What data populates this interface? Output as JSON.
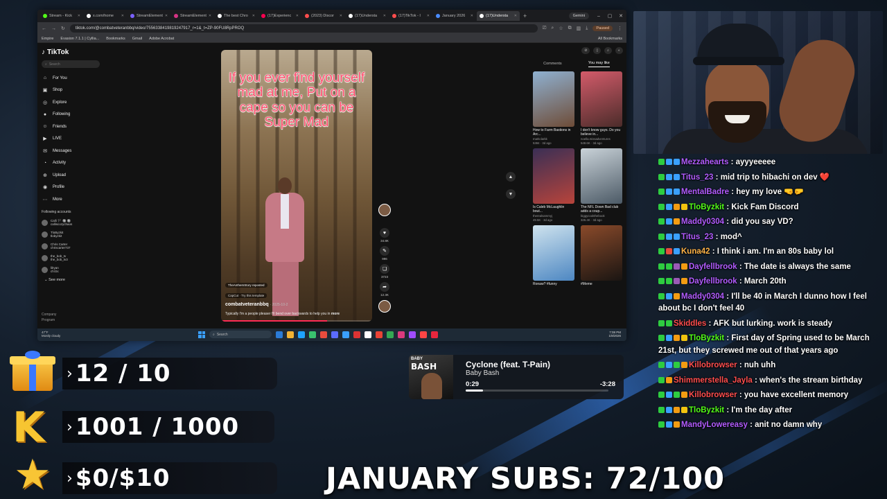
{
  "browser": {
    "tabs": [
      {
        "label": "Stream - Kick",
        "color": "#53fc18",
        "active": false
      },
      {
        "label": "x.com/home",
        "color": "#ffffff",
        "active": false
      },
      {
        "label": "StreamElement",
        "color": "#7b61ff",
        "active": false
      },
      {
        "label": "StreamElement",
        "color": "#d63384",
        "active": false
      },
      {
        "label": "The best Chro",
        "color": "#ffffff",
        "active": false
      },
      {
        "label": "(17)Experienc",
        "color": "#ff0050",
        "active": false
      },
      {
        "label": "(2023) Discor",
        "color": "#ff4d4d",
        "active": false
      },
      {
        "label": "(17)Understa",
        "color": "#ffffff",
        "active": false
      },
      {
        "label": "(17)TikTok - I",
        "color": "#ff4d4d",
        "active": false
      },
      {
        "label": "January 2026",
        "color": "#4a8cff",
        "active": false
      },
      {
        "label": "(17)Understa",
        "color": "#ffffff",
        "active": true
      }
    ],
    "new_tab": "+",
    "gemini_label": "Gemini",
    "window_controls": [
      "–",
      "▢",
      "✕"
    ],
    "url": "tiktok.com/@combatveteranbbq/video/7556338419819247917_r=1&_t=ZP-90FU8RpPROQ",
    "paused_label": "Paused",
    "bookmarks": [
      "Empire",
      "Evasion 7.1.1 | Cyllia...",
      "Bookmarks",
      "Gmail",
      "Adobe Acrobat"
    ],
    "all_bookmarks": "All Bookmarks"
  },
  "tiktok": {
    "logo": "TikTok",
    "search_placeholder": "Search",
    "nav": [
      {
        "label": "For You",
        "icon": "home-icon",
        "glyph": "⌂"
      },
      {
        "label": "Shop",
        "icon": "shop-icon",
        "glyph": "▣"
      },
      {
        "label": "Explore",
        "icon": "compass-icon",
        "glyph": "◎"
      },
      {
        "label": "Following",
        "icon": "following-icon",
        "glyph": "●"
      },
      {
        "label": "Friends",
        "icon": "friends-icon",
        "glyph": "☺"
      },
      {
        "label": "LIVE",
        "icon": "live-icon",
        "glyph": "▶"
      },
      {
        "label": "Messages",
        "icon": "messages-icon",
        "glyph": "✉"
      },
      {
        "label": "Activity",
        "icon": "activity-icon",
        "glyph": "◔"
      },
      {
        "label": "Upload",
        "icon": "upload-icon",
        "glyph": "⊕"
      },
      {
        "label": "Profile",
        "icon": "profile-icon",
        "glyph": "◉"
      },
      {
        "label": "More",
        "icon": "more-icon",
        "glyph": "⋯"
      }
    ],
    "following_title": "Following accounts",
    "following": [
      {
        "name": "Calli 🏳 🔘 🔘",
        "handle": "calliscozychaos"
      },
      {
        "name": "TloByzkit",
        "handle": "tlobyzkit"
      },
      {
        "name": "Chris Carter",
        "handle": "chriscarter737"
      },
      {
        "name": "the_bob_tv",
        "handle": "the_bob_tv3"
      },
      {
        "name": "lilryan",
        "handle": "chl.bc"
      }
    ],
    "see_more": "See more",
    "footer": [
      "Company",
      "Program"
    ],
    "video": {
      "caption": "If you ever find yourself mad at me, Put on a cape so you can be Super Mad",
      "reposted_tag": "TheAnthemStory reposted",
      "capcut": "CapCut · Try this template",
      "handle": "combatveteranbbq",
      "date": "· 2025-10-2",
      "description": "Typically I'm a people pleaser I'll bend over backwards to help you in",
      "more": "more",
      "progress": 0.7
    },
    "actions": [
      {
        "name": "like-icon",
        "glyph": "♥",
        "count": "34.8K"
      },
      {
        "name": "comment-icon",
        "glyph": "✎",
        "count": "996"
      },
      {
        "name": "bookmark-icon",
        "glyph": "❏",
        "count": "3723"
      },
      {
        "name": "share-icon",
        "glyph": "➦",
        "count": "12.3K"
      }
    ],
    "scroll_up": "▲",
    "scroll_down": "▼",
    "panel_tabs": [
      "Comments",
      "You may like"
    ],
    "panel_icons": [
      "⊘",
      "▯",
      "⌕",
      "◐"
    ],
    "suggestions": [
      {
        "title": "How to Farm Bastions in Arc...",
        "author": "markclarkk",
        "views": "5384",
        "age": "3d ago",
        "c1": "#8fb1d1",
        "c2": "#6e4c37"
      },
      {
        "title": "I don't know guys. Do you believe in...",
        "author": "noella.missadventures",
        "views": "548.6K",
        "age": "3d ago",
        "c1": "#d35b6a",
        "c2": "#4b2c2a"
      },
      {
        "title": "Is Caleb McLaughlin bout...",
        "author": "therealsammyj",
        "views": "49.5K",
        "age": "3d ago",
        "c1": "#3a2f55",
        "c2": "#b8443b"
      },
      {
        "title": "The NFL Down Bad club adds a coup...",
        "author": "biggycookthebook",
        "views": "326.4K",
        "age": "3d ago",
        "c1": "#c9d2d8",
        "c2": "#4c5a66"
      },
      {
        "title": "Ronaw? #funny",
        "author": "",
        "views": "",
        "age": "",
        "c1": "#cfe3ee",
        "c2": "#4d87c2"
      },
      {
        "title": "#Meme",
        "author": "",
        "views": "",
        "age": "",
        "c1": "#8a4a2a",
        "c2": "#1a1512"
      }
    ]
  },
  "taskbar": {
    "weather_temp": "47°F",
    "weather_desc": "Mostly cloudy",
    "search_placeholder": "Search",
    "apps": [
      "#2b7bd6",
      "#f2b233",
      "#1fa3ff",
      "#3ac26e",
      "#e84c3d",
      "#5b6cff",
      "#3aa0ff",
      "#d33",
      "#ffffff",
      "#ea4335",
      "#34a853",
      "#db3a7d",
      "#a14dff",
      "#ff4545",
      "#e8263d"
    ],
    "time": "7:08 PM",
    "date": "1/8/2026"
  },
  "chat": [
    {
      "user": "Mezzahearts",
      "color": "#b25cff",
      "text": "ayyyeeeee",
      "badges": [
        "#2ecc40",
        "#3aa0ff",
        "#3aa0ff"
      ]
    },
    {
      "user": "Titus_23",
      "color": "#b25cff",
      "text": "mid trip to hibachi on dev ❤️",
      "badges": [
        "#2ecc40",
        "#3aa0ff",
        "#3aa0ff"
      ]
    },
    {
      "user": "MentalBadre",
      "color": "#b25cff",
      "text": "hey my love 🤜🤛",
      "badges": [
        "#2ecc40",
        "#3aa0ff",
        "#3aa0ff"
      ]
    },
    {
      "user": "TloByzkit",
      "color": "#53fc18",
      "text": "Kick Fam Discord",
      "badges": [
        "#2ecc40",
        "#3aa0ff",
        "#f39c12",
        "#f1c40f"
      ]
    },
    {
      "user": "Maddy0304",
      "color": "#b25cff",
      "text": "did you say VD?",
      "badges": [
        "#2ecc40",
        "#3aa0ff",
        "#f39c12"
      ]
    },
    {
      "user": "Titus_23",
      "color": "#b25cff",
      "text": "mod^",
      "badges": [
        "#2ecc40",
        "#3aa0ff",
        "#3aa0ff"
      ]
    },
    {
      "user": "Kuna42",
      "color": "#ffb347",
      "text": "I think i am. I'm an 80s baby lol",
      "badges": [
        "#2ecc40",
        "#e74c3c",
        "#3aa0ff"
      ]
    },
    {
      "user": "Dayfellbrook",
      "color": "#b25cff",
      "text": "The date is always the same",
      "badges": [
        "#2ecc40",
        "#2ecc40",
        "#9b59b6",
        "#f39c12"
      ]
    },
    {
      "user": "Dayfellbrook",
      "color": "#b25cff",
      "text": "March 20th",
      "badges": [
        "#2ecc40",
        "#2ecc40",
        "#9b59b6",
        "#f39c12"
      ]
    },
    {
      "user": "Maddy0304",
      "color": "#b25cff",
      "text": "I'll be 40 in March I dunno how I feel about bc I don't feel 40",
      "badges": [
        "#2ecc40",
        "#3aa0ff",
        "#f39c12"
      ]
    },
    {
      "user": "Skiddles",
      "color": "#ff4d4d",
      "text": "AFK but lurking. work is steady",
      "badges": [
        "#2ecc40",
        "#2ecc40"
      ]
    },
    {
      "user": "TloByzkit",
      "color": "#53fc18",
      "text": "First day of Spring used to be March 21st, but they screwed me out of that years ago",
      "badges": [
        "#2ecc40",
        "#3aa0ff",
        "#f39c12",
        "#f1c40f"
      ]
    },
    {
      "user": "Killobrowser",
      "color": "#ff4d4d",
      "text": "nuh uhh",
      "badges": [
        "#2ecc40",
        "#3aa0ff",
        "#2ecc40",
        "#f39c12"
      ]
    },
    {
      "user": "Shimmerstella_Jayla",
      "color": "#ff4d4d",
      "text": "when's the stream birthday",
      "badges": [
        "#2ecc40",
        "#f39c12"
      ]
    },
    {
      "user": "Killobrowser",
      "color": "#ff4d4d",
      "text": "you have excellent memory",
      "badges": [
        "#2ecc40",
        "#3aa0ff",
        "#2ecc40",
        "#f39c12"
      ]
    },
    {
      "user": "TloByzkit",
      "color": "#53fc18",
      "text": "I'm the day after",
      "badges": [
        "#2ecc40",
        "#3aa0ff",
        "#f39c12",
        "#f1c40f"
      ]
    },
    {
      "user": "MandyLowereasy",
      "color": "#b25cff",
      "text": "anit no damn why",
      "badges": [
        "#2ecc40",
        "#3aa0ff",
        "#f39c12"
      ]
    }
  ],
  "goals": [
    {
      "icon": "gift-icon",
      "value": "12 / 10"
    },
    {
      "icon": "kick-k-icon",
      "value": "1001 / 1000"
    },
    {
      "icon": "star-icon",
      "value": "$0/$10"
    }
  ],
  "goal_chevron": "›",
  "now_playing": {
    "title": "Cyclone (feat. T-Pain)",
    "artist": "Baby Bash",
    "art_small": "BABY",
    "art_big": "BASH",
    "elapsed": "0:29",
    "remaining": "-3:28",
    "progress": 0.12
  },
  "subs_text": "JANUARY SUBS: 72/100"
}
